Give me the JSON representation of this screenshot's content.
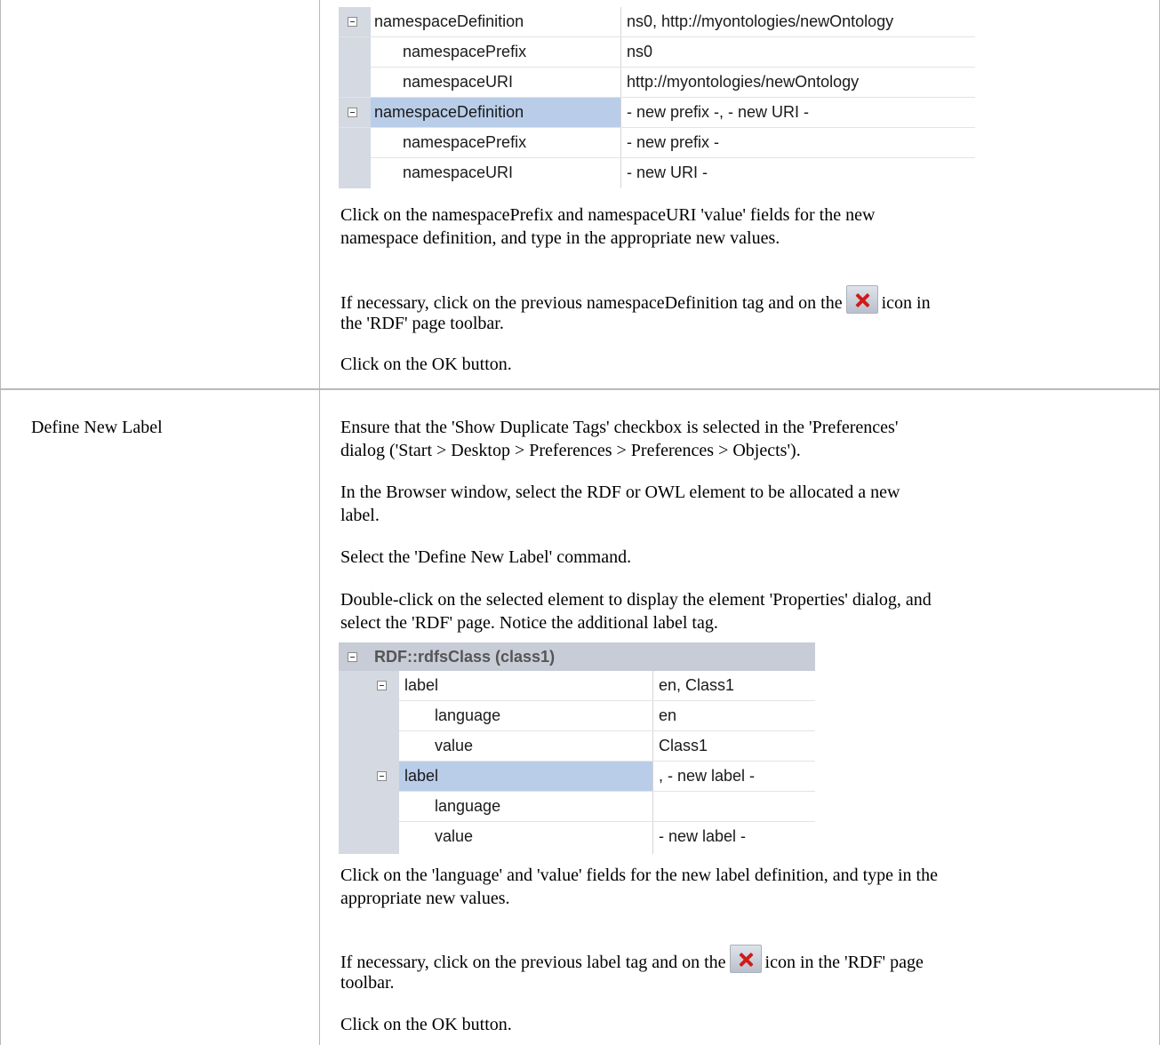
{
  "row1": {
    "grid": {
      "rows": [
        {
          "name": "namespaceDefinition",
          "value": "ns0, http://myontologies/newOntology"
        },
        {
          "name": "namespacePrefix",
          "value": "ns0"
        },
        {
          "name": "namespaceURI",
          "value": "http://myontologies/newOntology"
        },
        {
          "name": "namespaceDefinition",
          "value": "- new prefix -, - new URI -"
        },
        {
          "name": "namespacePrefix",
          "value": "- new prefix -"
        },
        {
          "name": "namespaceURI",
          "value": "- new URI -"
        }
      ]
    },
    "para1_line1": "Click on the namespacePrefix and namespaceURI 'value' fields for the new",
    "para1_line2": "namespace definition, and type in the appropriate new values.",
    "para2_pre": "If necessary, click on the previous namespaceDefinition tag and on the",
    "para2_post": "icon in",
    "para2_line2": "the 'RDF' page toolbar.",
    "para3": "Click on the OK button."
  },
  "row2": {
    "label": "Define New Label",
    "p1_line1": "Ensure that the 'Show Duplicate Tags' checkbox is selected in the 'Preferences'",
    "p1_line2": "dialog ('Start > Desktop > Preferences > Preferences > Objects').",
    "p2_line1": "In the Browser window, select the RDF or OWL element to be allocated a new",
    "p2_line2": "label.",
    "p3": "Select the 'Define New Label' command.",
    "p4_line1": "Double-click on the selected element to display the element 'Properties' dialog, and",
    "p4_line2": "select the 'RDF' page. Notice the additional label tag.",
    "grid": {
      "header": "RDF::rdfsClass (class1)",
      "rows": [
        {
          "name": "label",
          "value": "en, Class1"
        },
        {
          "name": "language",
          "value": "en"
        },
        {
          "name": "value",
          "value": "Class1"
        },
        {
          "name": "label",
          "value": ", - new label -"
        },
        {
          "name": "language",
          "value": ""
        },
        {
          "name": "value",
          "value": "- new label -"
        }
      ]
    },
    "p5_line1": "Click on the 'language' and 'value' fields for the new label definition, and type in the",
    "p5_line2": "appropriate new values.",
    "p6_pre": "If necessary, click on the previous label tag and on the",
    "p6_post": "icon in the 'RDF' page",
    "p6_line2": "toolbar.",
    "p7": "Click on the OK button."
  },
  "icons": [
    "delete-x-icon",
    "collapse-minus-icon"
  ]
}
